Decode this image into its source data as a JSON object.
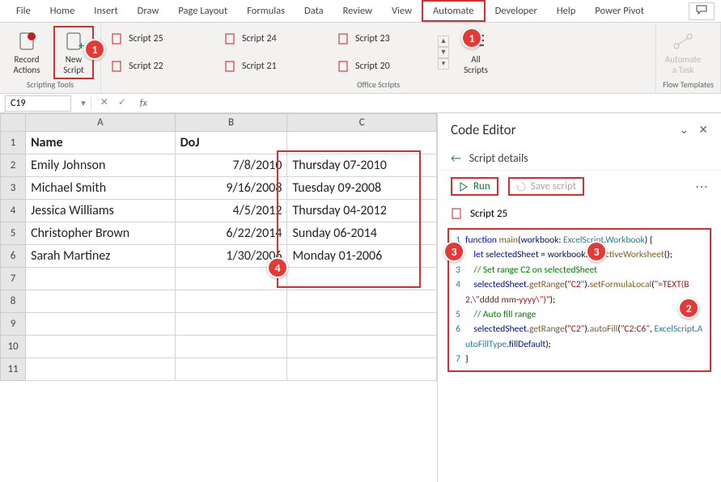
{
  "ribbon": {
    "tabs": [
      "File",
      "Home",
      "Insert",
      "Draw",
      "Page Layout",
      "Formulas",
      "Data",
      "Review",
      "View",
      "Automate",
      "Developer",
      "Help",
      "Power Pivot"
    ],
    "active_tab": "Automate",
    "groups": {
      "scripting_tools": {
        "label": "Scripting Tools",
        "record": "Record\nActions",
        "new_script": "New\nScript"
      },
      "office_scripts": {
        "label": "Office Scripts",
        "items": [
          "Script 25",
          "Script 24",
          "Script 23",
          "Script 22",
          "Script 21",
          "Script 20"
        ],
        "all_scripts": "All\nScripts"
      },
      "flow_templates": {
        "label": "Flow Templates",
        "automate": "Automate\na Task"
      }
    }
  },
  "formula": {
    "name_box": "C19"
  },
  "sheet": {
    "cols": [
      "A",
      "B",
      "C"
    ],
    "headers": {
      "A": "Name",
      "B": "DoJ",
      "C": ""
    },
    "rows": [
      {
        "n": "2",
        "A": "Emily Johnson",
        "B": "7/8/2010",
        "C": "Thursday 07-2010"
      },
      {
        "n": "3",
        "A": "Michael Smith",
        "B": "9/16/2008",
        "C": "Tuesday 09-2008"
      },
      {
        "n": "4",
        "A": "Jessica Williams",
        "B": "4/5/2012",
        "C": "Thursday 04-2012"
      },
      {
        "n": "5",
        "A": "Christopher Brown",
        "B": "6/22/2014",
        "C": "Sunday 06-2014"
      },
      {
        "n": "6",
        "A": "Sarah Martinez",
        "B": "1/30/2006",
        "C": "Monday 01-2006"
      }
    ]
  },
  "panel": {
    "title": "Code Editor",
    "sub": "Script details",
    "run": "Run",
    "save": "Save script",
    "script_name": "Script 25"
  },
  "code": {
    "lines": [
      {
        "n": "1",
        "html": "<span class='kw'>function</span> <span class='fn'>main</span>(<span class='ident'>workbook</span>: <span class='type'>ExcelScript</span>.<span class='type'>Workbook</span>) {"
      },
      {
        "n": "2",
        "html": "    <span class='kw'>let</span> <span class='ident'>selectedSheet</span> = <span class='ident'>workbook</span>.<span class='fn'>getActiveWorksheet</span>();"
      },
      {
        "n": "3",
        "html": "    <span class='cmt'>// Set range C2 on selectedSheet</span>"
      },
      {
        "n": "4",
        "html": "    <span class='ident'>selectedSheet</span>.<span class='fn'>getRange</span>(<span class='str'>\"C2\"</span>).<span class='fn'>setFormulaLocal</span>(<span class='str'>\"=TEXT(B2,\\\"dddd mm-yyyy\\\")\"</span>);"
      },
      {
        "n": "5",
        "html": "    <span class='cmt'>// Auto fill range</span>"
      },
      {
        "n": "6",
        "html": "    <span class='ident'>selectedSheet</span>.<span class='fn'>getRange</span>(<span class='str'>\"C2\"</span>).<span class='fn'>autoFill</span>(<span class='str'>\"C2:C6\"</span>, <span class='type'>ExcelScript</span>.<span class='type'>AutoFillType</span>.<span class='ident'>fillDefault</span>);"
      },
      {
        "n": "7",
        "html": "}"
      }
    ]
  },
  "callouts": {
    "1a": "1",
    "1b": "1",
    "2": "2",
    "3a": "3",
    "3b": "3",
    "4": "4"
  }
}
